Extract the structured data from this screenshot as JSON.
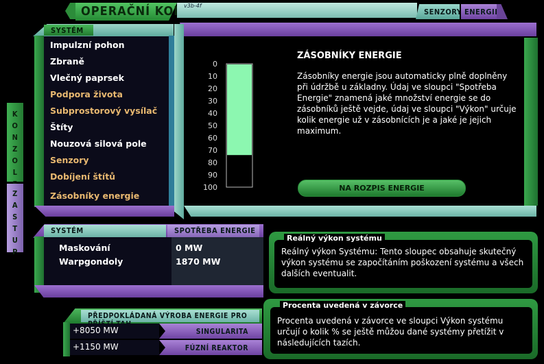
{
  "header": {
    "title": "OPERAČNÍ KONZOLE",
    "small_text": "v3b-4f",
    "tabs": [
      {
        "label": "SENZORY"
      },
      {
        "label": "ENERGIE"
      }
    ]
  },
  "side_rail": {
    "top_label": "KONZOLE",
    "bottom_label": "ZASTUP"
  },
  "system_panel": {
    "header": "SYSTÉM",
    "items": [
      {
        "label": "Impulzní pohon",
        "color": "#ffffff"
      },
      {
        "label": "Zbraně",
        "color": "#ffffff"
      },
      {
        "label": "Vlečný paprsek",
        "color": "#ffffff"
      },
      {
        "label": "Podpora života",
        "color": "#e8b870"
      },
      {
        "label": "Subprostorový vysílač",
        "color": "#e8b870"
      },
      {
        "label": "Štíty",
        "color": "#ffffff"
      },
      {
        "label": "Nouzová silová pole",
        "color": "#ffffff"
      },
      {
        "label": "Senzory",
        "color": "#e8b870"
      },
      {
        "label": "Dobíjení štítů",
        "color": "#e8b870"
      },
      {
        "label": "Zásobníky energie",
        "color": "#e8b870"
      }
    ]
  },
  "main": {
    "title": "ZÁSOBNÍKY ENERGIE",
    "description": "Zásobníky energie jsou automaticky plně doplněny při údržbě u základny. Údaj ve sloupci \"Spotřeba Energie\" znamená jaké množství energie se do zásobníků ještě vejde, údaj ve sloupci \"Výkon\" určuje kolik energie už v zásobnících je a jaké je jejich maximum.",
    "button_label": "NA ROZPIS ENERGIE"
  },
  "chart_data": {
    "type": "bar",
    "categories": [
      ""
    ],
    "values": [
      74
    ],
    "ylim": [
      0,
      100
    ],
    "y_ticks": [
      "0",
      "10",
      "20",
      "30",
      "40",
      "50",
      "60",
      "70",
      "80",
      "90",
      "100"
    ],
    "fill_color": "#8cf7b0"
  },
  "consumption": {
    "col1_header": "SYSTÉM",
    "col2_header": "SPOTŘEBA ENERGIE",
    "rows": [
      {
        "system": "Maskování",
        "value": "0 MW"
      },
      {
        "system": "Warpgondoly",
        "value": "1870 MW"
      }
    ]
  },
  "projection": {
    "header": "PŘEDPOKLÁDANÁ VÝROBA ENERGIE PRO PŘÍŠTÍ TAH",
    "rows": [
      {
        "value": "+8050 MW",
        "label": "SINGULARITA"
      },
      {
        "value": "+1150 MW",
        "label": "FÚZNÍ REAKTOR"
      }
    ]
  },
  "info1": {
    "title": "Reálný výkon systému",
    "text": "Reálný výkon Systému: Tento sloupec obsahuje skutečný výkon systému se započítáním poškození systému a všech dalších eventualit."
  },
  "info2": {
    "title": "Procenta uvedená v závorce",
    "text": "Procenta uvedená v závorce ve sloupci Výkon systému určují o kolik % se ještě můžou dané systémy přetížit v následujících tazích."
  }
}
